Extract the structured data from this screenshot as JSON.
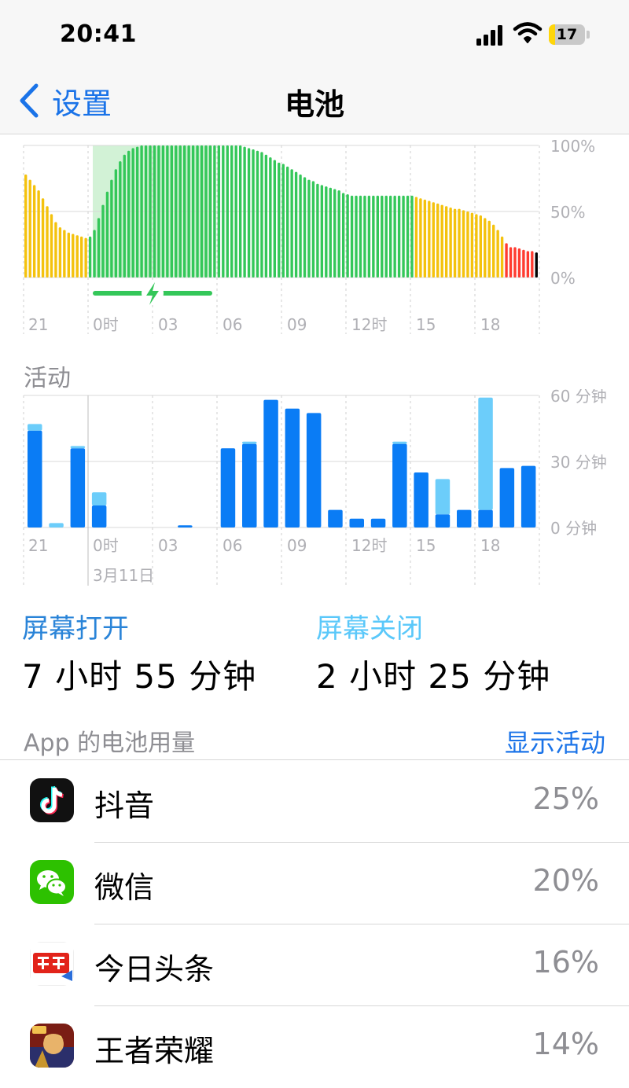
{
  "status_bar": {
    "time": "20:41",
    "battery": "17",
    "battery_level": 0.17
  },
  "nav": {
    "back_label": "设置",
    "title": "电池"
  },
  "battery_chart": {
    "chart_data": {
      "type": "bar",
      "title": "",
      "ylim": [
        0,
        100
      ],
      "y_ticks": [
        "100%",
        "50%",
        "0%"
      ],
      "x_ticks": [
        "21",
        "0时",
        "03",
        "06",
        "09",
        "12时",
        "15",
        "18"
      ],
      "values": [
        78,
        74,
        70,
        66,
        60,
        54,
        48,
        42,
        38,
        36,
        34,
        33,
        32,
        31,
        30,
        31,
        36,
        45,
        55,
        65,
        74,
        82,
        88,
        93,
        96,
        98,
        99,
        100,
        100,
        100,
        100,
        100,
        100,
        100,
        100,
        100,
        100,
        100,
        100,
        100,
        100,
        100,
        100,
        100,
        100,
        100,
        100,
        100,
        100,
        100,
        100,
        99,
        98,
        97,
        96,
        95,
        93,
        91,
        89,
        87,
        86,
        84,
        82,
        80,
        78,
        76,
        74,
        73,
        71,
        70,
        69,
        68,
        67,
        66,
        64,
        63,
        62,
        62,
        62,
        62,
        62,
        62,
        62,
        62,
        62,
        62,
        62,
        62,
        62,
        62,
        62,
        61,
        60,
        59,
        58,
        57,
        56,
        55,
        54,
        53,
        52,
        52,
        51,
        50,
        49,
        48,
        47,
        45,
        43,
        40,
        36,
        31,
        26,
        23,
        23,
        22,
        21,
        20,
        20,
        19
      ],
      "colors_by_bar": [
        "yellow",
        "yellow",
        "yellow",
        "yellow",
        "yellow",
        "yellow",
        "yellow",
        "yellow",
        "yellow",
        "yellow",
        "yellow",
        "yellow",
        "yellow",
        "yellow",
        "yellow",
        "green",
        "green",
        "green",
        "green",
        "green",
        "green",
        "green",
        "green",
        "green",
        "green",
        "green",
        "green",
        "green",
        "green",
        "green",
        "green",
        "green",
        "green",
        "green",
        "green",
        "green",
        "green",
        "green",
        "green",
        "green",
        "green",
        "green",
        "green",
        "green",
        "green",
        "green",
        "green",
        "green",
        "green",
        "green",
        "green",
        "green",
        "green",
        "green",
        "green",
        "green",
        "green",
        "green",
        "green",
        "green",
        "green",
        "green",
        "green",
        "green",
        "green",
        "green",
        "green",
        "green",
        "green",
        "green",
        "green",
        "green",
        "green",
        "green",
        "green",
        "green",
        "green",
        "green",
        "green",
        "green",
        "green",
        "green",
        "green",
        "green",
        "green",
        "green",
        "green",
        "green",
        "green",
        "green",
        "green",
        "yellow",
        "yellow",
        "yellow",
        "yellow",
        "yellow",
        "yellow",
        "yellow",
        "yellow",
        "yellow",
        "yellow",
        "yellow",
        "yellow",
        "yellow",
        "yellow",
        "yellow",
        "yellow",
        "yellow",
        "yellow",
        "yellow",
        "yellow",
        "yellow",
        "red",
        "red",
        "red",
        "red",
        "red",
        "red",
        "red"
      ],
      "palette": {
        "yellow": "#f4c20d",
        "green": "#34c759",
        "red": "#ff3b30",
        "charging": "#c7efcc"
      },
      "charging_indicator": "bolt-icon",
      "grid": true
    }
  },
  "activity_chart": {
    "label": "活动",
    "date_label": "3月11日",
    "chart_data": {
      "type": "bar",
      "title": "",
      "ylim": [
        0,
        60
      ],
      "y_ticks": [
        "60 分钟",
        "30 分钟",
        "0 分钟"
      ],
      "x_ticks": [
        "21",
        "0时",
        "03",
        "06",
        "09",
        "12时",
        "15",
        "18"
      ],
      "categories": [
        "21",
        "22",
        "23",
        "0",
        "1",
        "2",
        "3",
        "4",
        "5",
        "6",
        "7",
        "8",
        "9",
        "10",
        "11",
        "12",
        "13",
        "14",
        "15",
        "16",
        "17",
        "18",
        "19",
        "20"
      ],
      "series": [
        {
          "name": "屏幕打开",
          "color": "#0a7cf5",
          "values": [
            44,
            0,
            36,
            10,
            0,
            0,
            0,
            1,
            0,
            36,
            38,
            58,
            54,
            52,
            8,
            4,
            4,
            38,
            25,
            6,
            8,
            0,
            27,
            28
          ]
        },
        {
          "name": "屏幕关闭",
          "color": "#6ccdfa",
          "values": [
            3,
            2,
            1,
            6,
            0,
            0,
            0,
            0,
            0,
            0,
            1,
            0,
            0,
            0,
            0,
            0,
            0,
            1,
            0,
            16,
            0,
            0,
            0,
            0
          ]
        }
      ],
      "extra_top": {
        "index": 21,
        "dark": 8,
        "light": 51
      },
      "grid": true
    }
  },
  "screen_on": {
    "title": "屏幕打开",
    "value": "7 小时 55 分钟",
    "color": "#2a84d8"
  },
  "screen_off": {
    "title": "屏幕关闭",
    "value": "2 小时 25 分钟",
    "color": "#5ac8fa"
  },
  "apps_header": {
    "title": "App 的电池用量",
    "action": "显示活动"
  },
  "apps": [
    {
      "name": "抖音",
      "percent": "25%",
      "icon": "douyin-icon"
    },
    {
      "name": "微信",
      "percent": "20%",
      "icon": "wechat-icon"
    },
    {
      "name": "今日头条",
      "percent": "16%",
      "icon": "toutiao-icon"
    },
    {
      "name": "王者荣耀",
      "percent": "14%",
      "icon": "honor-of-kings-icon"
    }
  ]
}
